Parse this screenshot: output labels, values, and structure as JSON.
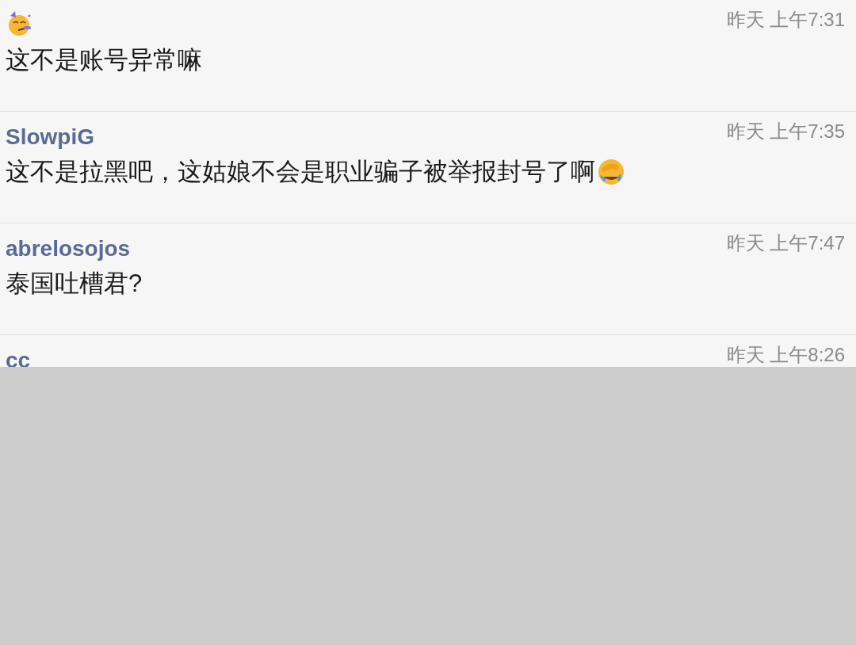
{
  "comments": [
    {
      "author_icon": true,
      "time": "昨天 上午7:31",
      "text": "这不是账号异常嘛",
      "trailing_icon": false
    },
    {
      "author": "SlowpiG",
      "time": "昨天 上午7:35",
      "text": "这不是拉黑吧，这姑娘不会是职业骗子被举报封号了啊",
      "trailing_icon": true
    },
    {
      "author": "abrelosojos",
      "time": "昨天 上午7:47",
      "text": "泰国吐槽君?",
      "trailing_icon": false
    },
    {
      "author": "cc",
      "time": "昨天 上午8:26",
      "trailing_icon": false
    }
  ]
}
